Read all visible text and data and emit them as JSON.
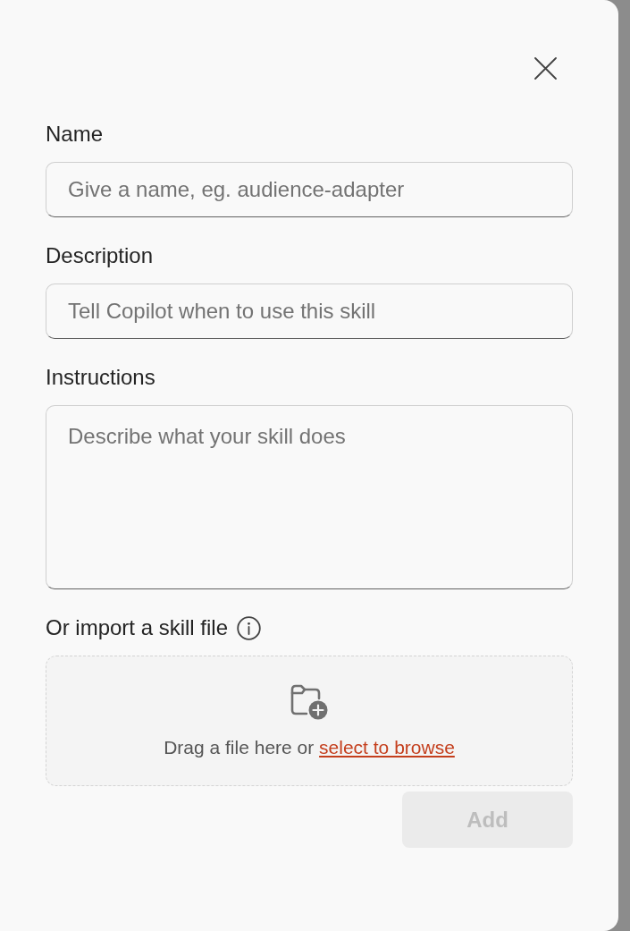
{
  "fields": [
    {
      "kind": "input",
      "label": "Name",
      "placeholder": "Give a name, eg. audience-adapter"
    },
    {
      "kind": "input",
      "label": "Description",
      "placeholder": "Tell Copilot when to use this skill"
    },
    {
      "kind": "textarea",
      "label": "Instructions",
      "placeholder": "Describe what your skill does"
    }
  ],
  "import": {
    "label": "Or import a skill file",
    "drop_zone": {
      "text": "Drag a file here or",
      "link": "select to browse"
    }
  },
  "buttons": [
    {
      "label": "Add",
      "disabled": true
    }
  ]
}
